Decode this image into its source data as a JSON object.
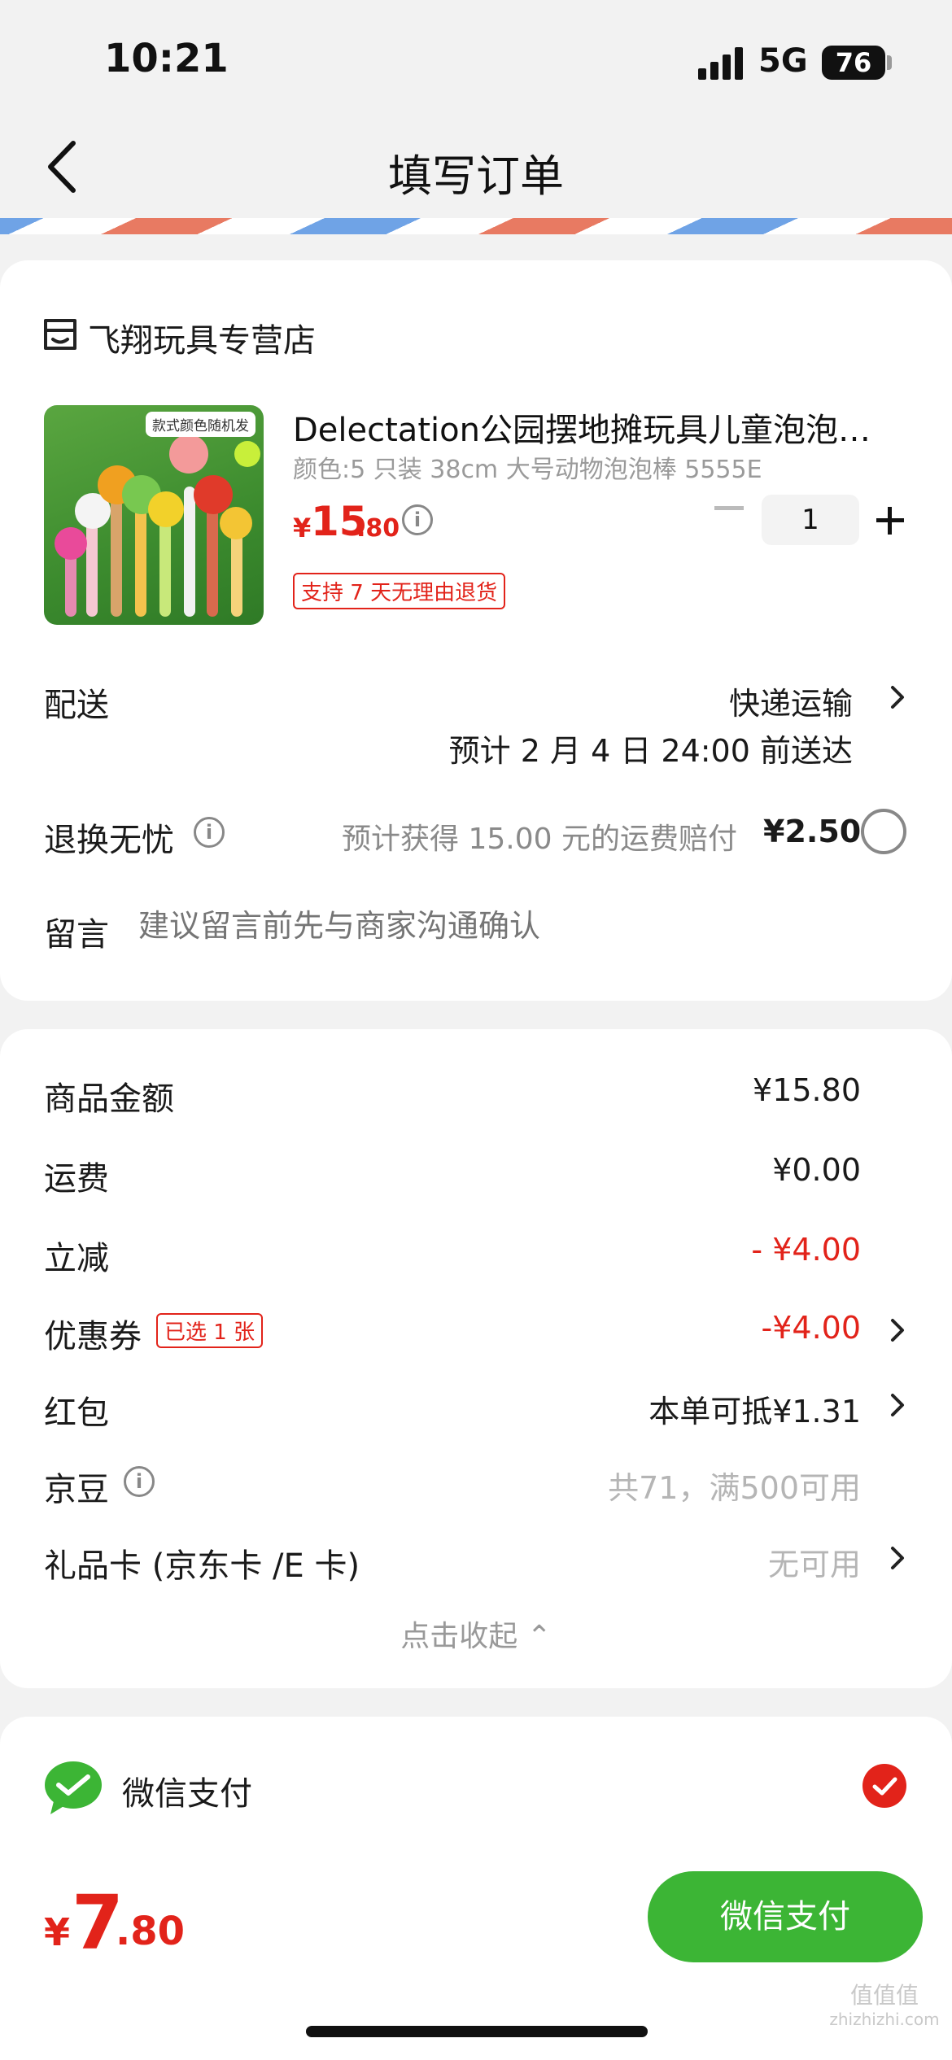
{
  "status_bar": {
    "time": "10:21",
    "network": "5G",
    "battery": "76"
  },
  "nav": {
    "title": "填写订单"
  },
  "store": {
    "name": "飞翔玩具专营店"
  },
  "product": {
    "thumbnail_tag": "款式颜色随机发",
    "title": "Delectation公园摆地摊玩具儿童泡泡剑…",
    "spec": "颜色:5 只装 38cm 大号动物泡泡棒 5555E",
    "price_symbol": "¥",
    "price_int": "15",
    "price_dec": ".80",
    "quantity": "1",
    "return_badge": "支持 7 天无理由退货"
  },
  "delivery": {
    "label": "配送",
    "method": "快递运输",
    "eta": "预计 2 月 4 日 24:00 前送达"
  },
  "worry_free": {
    "label": "退换无忧",
    "desc": "预计获得 15.00 元的运费赔付",
    "price": "¥2.50"
  },
  "message": {
    "label": "留言",
    "placeholder": "建议留言前先与商家沟通确认"
  },
  "summary": {
    "rows": [
      {
        "label": "商品金额",
        "value": "¥15.80"
      },
      {
        "label": "运费",
        "value": "¥0.00"
      },
      {
        "label": "立减",
        "value": "- ¥4.00"
      },
      {
        "label": "优惠券",
        "badge": "已选 1 张",
        "value": "-¥4.00"
      },
      {
        "label": "红包",
        "value": "本单可抵¥1.31"
      },
      {
        "label": "京豆",
        "value": "共71，满500可用"
      },
      {
        "label": "礼品卡 (京东卡 /E 卡)",
        "value": "无可用"
      }
    ],
    "collapse": "点击收起 ⌃"
  },
  "payment": {
    "method": "微信支付",
    "total_symbol": "¥",
    "total_int": "7",
    "total_dec": ".80",
    "button": "微信支付"
  },
  "watermark": {
    "line1": "值值值",
    "line2": "zhizhizhi.com"
  },
  "colors": {
    "accent_red": "#e2231a",
    "wechat_green": "#3cb535"
  }
}
